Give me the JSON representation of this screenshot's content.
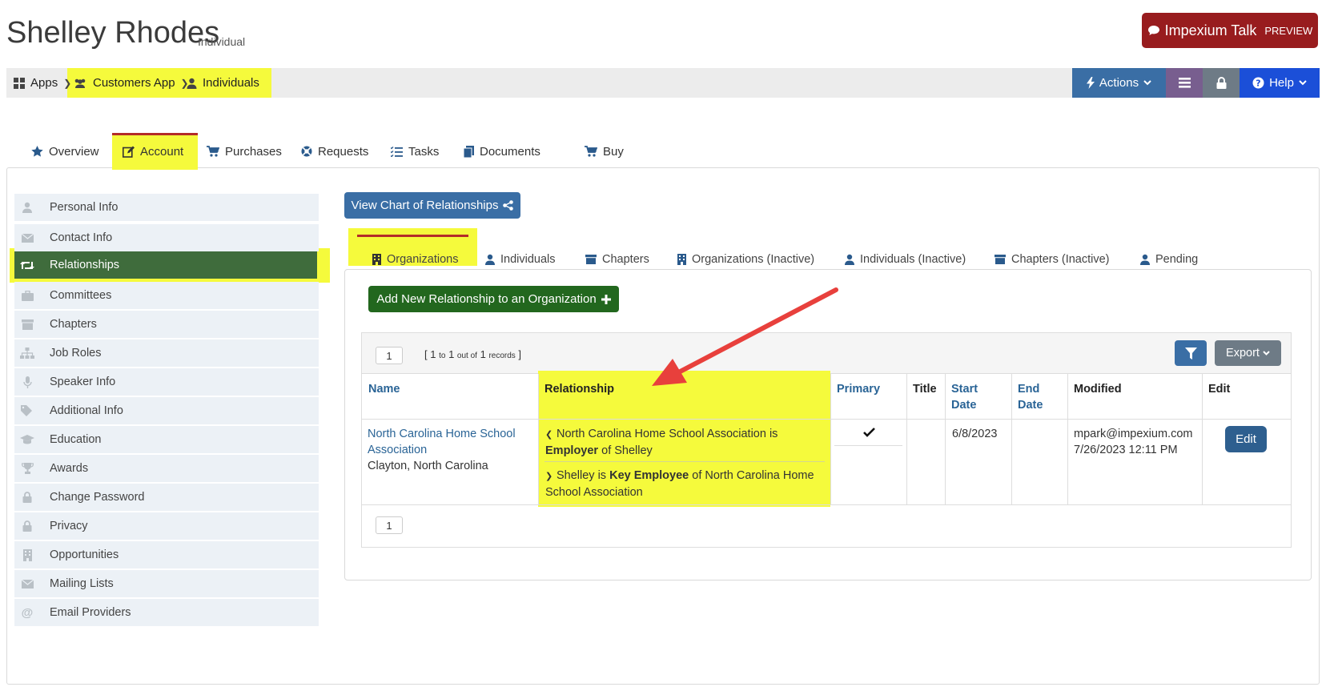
{
  "header": {
    "title": "Shelley Rhodes",
    "subtitle": "Individual",
    "talk_label": "Impexium Talk",
    "talk_preview": "PREVIEW"
  },
  "breadcrumb": {
    "apps": "Apps",
    "customers_app": "Customers App",
    "individuals": "Individuals"
  },
  "actions": {
    "actions_label": "Actions",
    "help_label": "Help"
  },
  "main_tabs": [
    {
      "label": "Overview",
      "icon": "star-icon"
    },
    {
      "label": "Account",
      "icon": "edit-icon"
    },
    {
      "label": "Purchases",
      "icon": "cart-icon"
    },
    {
      "label": "Requests",
      "icon": "lifering-icon"
    },
    {
      "label": "Tasks",
      "icon": "tasks-icon"
    },
    {
      "label": "Documents",
      "icon": "documents-icon"
    },
    {
      "label": "Buy",
      "icon": "cart-icon"
    }
  ],
  "sidebar": {
    "items": [
      {
        "label": "Personal Info",
        "icon": "user-icon"
      },
      {
        "label": "Contact Info",
        "icon": "envelope-icon"
      },
      {
        "label": "Relationships",
        "icon": "retweet-icon"
      },
      {
        "label": "Committees",
        "icon": "briefcase-icon"
      },
      {
        "label": "Chapters",
        "icon": "archive-icon"
      },
      {
        "label": "Job Roles",
        "icon": "sitemap-icon"
      },
      {
        "label": "Speaker Info",
        "icon": "microphone-icon"
      },
      {
        "label": "Additional Info",
        "icon": "tags-icon"
      },
      {
        "label": "Education",
        "icon": "graduation-cap-icon"
      },
      {
        "label": "Awards",
        "icon": "trophy-icon"
      },
      {
        "label": "Change Password",
        "icon": "lock-icon"
      },
      {
        "label": "Privacy",
        "icon": "lock-icon"
      },
      {
        "label": "Opportunities",
        "icon": "building-icon"
      },
      {
        "label": "Mailing Lists",
        "icon": "envelope-icon"
      },
      {
        "label": "Email Providers",
        "icon": "at-icon"
      }
    ]
  },
  "content": {
    "view_chart_label": "View Chart of Relationships",
    "sub_tabs": [
      {
        "label": "Organizations",
        "icon": "building-icon"
      },
      {
        "label": "Individuals",
        "icon": "user-icon"
      },
      {
        "label": "Chapters",
        "icon": "archive-icon"
      },
      {
        "label": "Organizations (Inactive)",
        "icon": "building-icon"
      },
      {
        "label": "Individuals (Inactive)",
        "icon": "user-icon"
      },
      {
        "label": "Chapters (Inactive)",
        "icon": "archive-icon"
      },
      {
        "label": "Pending",
        "icon": "user-icon"
      }
    ],
    "add_relationship_label": "Add New Relationship to an Organization"
  },
  "grid": {
    "page_top": "1",
    "page_bottom": "1",
    "records": {
      "from": "1",
      "to_word": "to",
      "to": "1",
      "outof_word": "out of",
      "total": "1",
      "records_word": "records"
    },
    "export_label": "Export",
    "columns": {
      "name": "Name",
      "relationship": "Relationship",
      "primary": "Primary",
      "title": "Title",
      "start_date_1": "Start",
      "start_date_2": "Date",
      "end_date_1": "End",
      "end_date_2": "Date",
      "modified": "Modified",
      "edit": "Edit"
    },
    "row": {
      "name_line1": "North Carolina Home School",
      "name_line2": "Association",
      "location": "Clayton, North Carolina",
      "rel1_a": "North Carolina Home School Association is",
      "rel1_bold": "Employer",
      "rel1_b": "of Shelley",
      "rel2_a": "Shelley is",
      "rel2_bold": "Key Employee",
      "rel2_b": "of North Carolina Home",
      "rel2_c": "School Association",
      "start_date": "6/8/2023",
      "modified_by": "mpark@impexium.com",
      "modified_at": "7/26/2023 12:11 PM",
      "edit_label": "Edit"
    }
  },
  "colors": {
    "highlight": "#f5fa3c",
    "primary_blue": "#3a6ea5",
    "green": "#22671e",
    "talk_red": "#981c1e",
    "arrow_red": "#e8403c",
    "help_blue": "#1b4fd8"
  }
}
